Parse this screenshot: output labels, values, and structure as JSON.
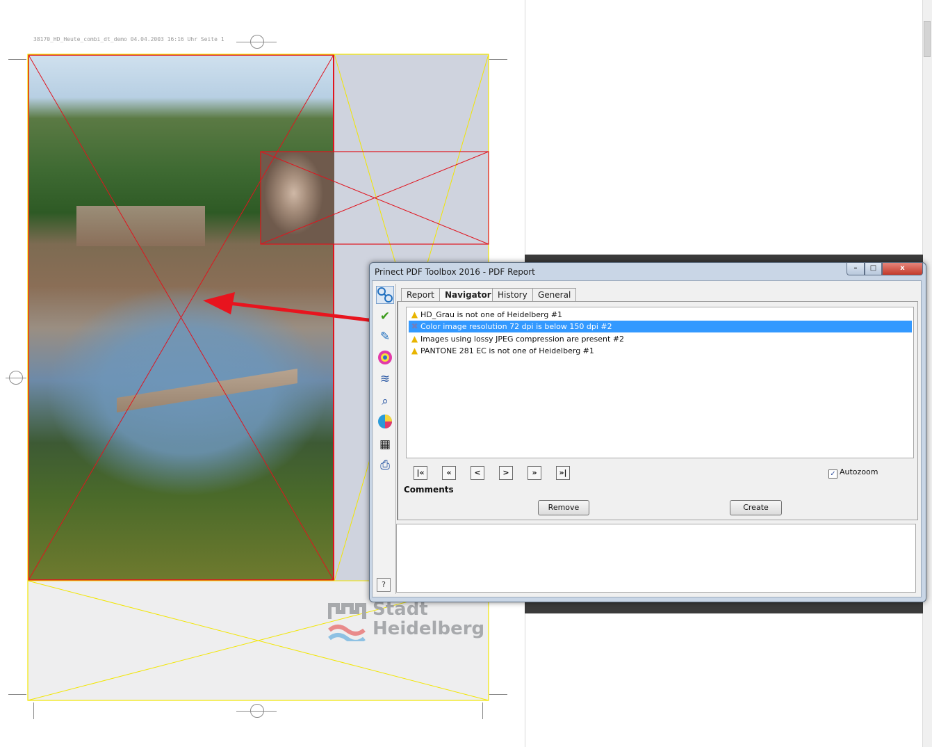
{
  "document": {
    "slug_line": "38170_HD_Heute_combi_dt_demo  04.04.2003  16:16 Uhr  Seite 1",
    "logo_line1": "Stadt",
    "logo_line2": "Heidelberg"
  },
  "dialog": {
    "title": "Prinect PDF Toolbox 2016 - PDF Report",
    "window_buttons": {
      "minimize": "–",
      "maximize": "□",
      "close": "x"
    },
    "sidebar_icons": [
      "navigator-icon",
      "check-icon",
      "fix-icon",
      "color-wheel-icon",
      "layers-icon",
      "inspect-icon",
      "separation-icon",
      "grid-icon",
      "preview-icon"
    ],
    "help_label": "?",
    "tabs": [
      {
        "label": "Report",
        "active": false
      },
      {
        "label": "Navigator",
        "active": true
      },
      {
        "label": "History",
        "active": false
      },
      {
        "label": "General",
        "active": false
      }
    ],
    "items": [
      {
        "icon": "warning-icon",
        "text": "HD_Grau is not one of Heidelberg #1",
        "selected": false
      },
      {
        "icon": "error-icon",
        "text": "Color image resolution 72 dpi is below 150 dpi #2",
        "selected": true
      },
      {
        "icon": "warning-icon",
        "text": "Images using lossy JPEG compression are present #2",
        "selected": false
      },
      {
        "icon": "warning-icon",
        "text": "PANTONE 281 EC is not one of Heidelberg #1",
        "selected": false
      }
    ],
    "nav_buttons": [
      "|«",
      "«",
      "<",
      ">",
      "»",
      "»|"
    ],
    "autozoom_label": "Autozoom",
    "autozoom_checked": true,
    "comments_label": "Comments",
    "remove_label": "Remove",
    "create_label": "Create"
  },
  "colors": {
    "trim_red": "#e0141e",
    "bleed_yellow": "#f2e600",
    "selection_blue": "#3399ff",
    "warning_yellow": "#e8b400"
  }
}
